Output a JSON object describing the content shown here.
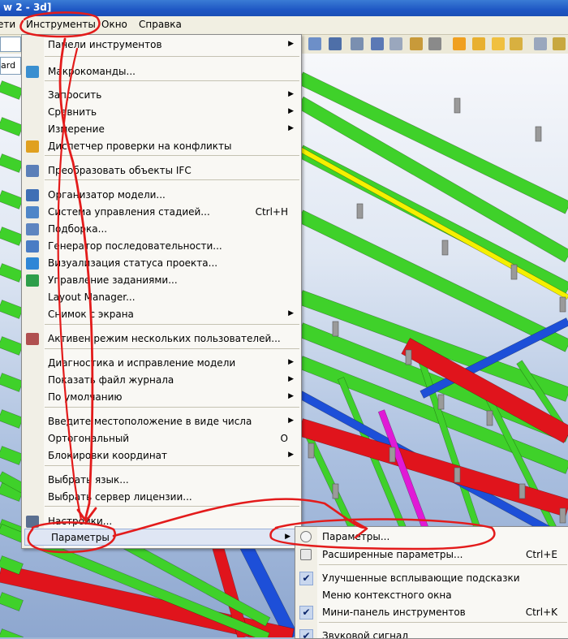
{
  "window": {
    "title_fragment": "w 2 - 3d]"
  },
  "menubar": {
    "items": [
      {
        "label": "ети"
      },
      {
        "label": "Инструменты"
      },
      {
        "label": "Окно"
      },
      {
        "label": "Справка"
      }
    ]
  },
  "toolbar": {
    "combo_fragment": "ard"
  },
  "tools_menu": {
    "items": [
      {
        "label": "Панели инструментов",
        "arrow": "▶"
      },
      {
        "label": "Макрокоманды..."
      },
      {
        "label": "Запросить",
        "arrow": "▶"
      },
      {
        "label": "Сравнить",
        "arrow": "▶"
      },
      {
        "label": "Измерение",
        "arrow": "▶"
      },
      {
        "label": "Диспетчер проверки на конфликты"
      },
      {
        "label": "Преобразовать объекты IFC"
      },
      {
        "label": "Организатор модели..."
      },
      {
        "label": "Система управления стадией...",
        "shortcut": "Ctrl+H"
      },
      {
        "label": "Подборка..."
      },
      {
        "label": "Генератор последовательности..."
      },
      {
        "label": "Визуализация статуса проекта..."
      },
      {
        "label": "Управление заданиями..."
      },
      {
        "label": "Layout Manager..."
      },
      {
        "label": "Снимок с экрана",
        "arrow": "▶"
      },
      {
        "label": "Активен режим нескольких пользователей..."
      },
      {
        "label": "Диагностика и исправление модели",
        "arrow": "▶"
      },
      {
        "label": "Показать файл журнала",
        "arrow": "▶"
      },
      {
        "label": "По умолчанию",
        "arrow": "▶"
      },
      {
        "label": "Введите местоположение в виде числа",
        "arrow": "▶"
      },
      {
        "label": "Ортогональный",
        "shortcut": "O"
      },
      {
        "label": "Блокировки координат",
        "arrow": "▶"
      },
      {
        "label": "Выбрать язык..."
      },
      {
        "label": "Выбрать сервер лицензии..."
      },
      {
        "label": "Настройки..."
      },
      {
        "label": "Параметры",
        "arrow": "▶"
      }
    ]
  },
  "params_submenu": {
    "items": [
      {
        "label": "Параметры..."
      },
      {
        "label": "Расширенные параметры...",
        "shortcut": "Ctrl+E"
      },
      {
        "label": "Улучшенные всплывающие подсказки",
        "checked": true
      },
      {
        "label": "Меню контекстного окна",
        "checked": false
      },
      {
        "label": "Мини-панель инструментов",
        "shortcut": "Ctrl+K",
        "checked": true
      },
      {
        "label": "Звуковой сигнал",
        "checked": true
      }
    ],
    "check_glyph": "✔"
  },
  "colors": {
    "annotation": "#e31b1b",
    "beam_green": "#3fd12a",
    "beam_red": "#e0141c",
    "beam_blue": "#1d4fd8",
    "beam_yellow": "#f5f000",
    "beam_magenta": "#e01ad6",
    "menu_highlight": "#dfe6f4"
  },
  "icons": [
    "macro-icon",
    "conflict-checker-icon",
    "ifc-convert-icon",
    "model-organizer-icon",
    "phase-manager-icon",
    "selection-icon",
    "sequence-generator-icon",
    "project-status-icon",
    "tasks-icon",
    "multiuser-icon",
    "settings-icon",
    "params-icon",
    "advanced-params-icon"
  ]
}
